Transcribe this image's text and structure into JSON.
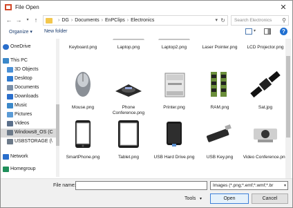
{
  "window": {
    "title": "File Open"
  },
  "address": {
    "crumbs": [
      "DG",
      "Documents",
      "EnPClips",
      "Electronics"
    ],
    "search_placeholder": "Search Electronics"
  },
  "commands": {
    "organize": "Organize ▾",
    "new_folder": "New folder"
  },
  "navigation": [
    {
      "label": "OneDrive",
      "icon": "cloud-icon",
      "color": "#2a6ecb"
    },
    {
      "label": "This PC",
      "icon": "computer-icon",
      "color": "#3b88c9"
    },
    {
      "label": "3D Objects",
      "icon": "cube-icon",
      "color": "#4a90d6"
    },
    {
      "label": "Desktop",
      "icon": "desktop-icon",
      "color": "#2f7bd0"
    },
    {
      "label": "Documents",
      "icon": "documents-icon",
      "color": "#7a8fa8"
    },
    {
      "label": "Downloads",
      "icon": "download-icon",
      "color": "#2a6ecb"
    },
    {
      "label": "Music",
      "icon": "music-icon",
      "color": "#3b88c9"
    },
    {
      "label": "Pictures",
      "icon": "pictures-icon",
      "color": "#5a9bd6"
    },
    {
      "label": "Videos",
      "icon": "videos-icon",
      "color": "#5a6f8a"
    },
    {
      "label": "Windows8_OS (C",
      "icon": "drive-icon",
      "color": "#6c7a89",
      "selected": true
    },
    {
      "label": "USBSTORAGE (\\",
      "icon": "usb-drive-icon",
      "color": "#6c7a89"
    },
    {
      "label": "Network",
      "icon": "network-icon",
      "color": "#2a6ecb"
    },
    {
      "label": "Homegroup",
      "icon": "homegroup-icon",
      "color": "#1f8f5a"
    }
  ],
  "files": [
    {
      "name": "Keyboard.png",
      "icon": "keyboard-icon"
    },
    {
      "name": "Laptop.png",
      "icon": "laptop-icon"
    },
    {
      "name": "Laptop2.png",
      "icon": "laptop-icon"
    },
    {
      "name": "Laser Pointer.png",
      "icon": "laser-pointer-icon"
    },
    {
      "name": "LCD Projector.png",
      "icon": "projector-icon"
    },
    {
      "name": "Mouse.png",
      "icon": "mouse-icon"
    },
    {
      "name": "Phone Conference.png",
      "icon": "conference-phone-icon"
    },
    {
      "name": "Printer.png",
      "icon": "printer-icon"
    },
    {
      "name": "RAM.png",
      "icon": "ram-icon"
    },
    {
      "name": "Sat.jpg",
      "icon": "satellite-icon"
    },
    {
      "name": "SmartPhone.png",
      "icon": "smartphone-icon"
    },
    {
      "name": "Tablet.png",
      "icon": "tablet-icon"
    },
    {
      "name": "USB Hard Drive.png",
      "icon": "hard-drive-icon"
    },
    {
      "name": "USB Key.png",
      "icon": "usb-key-icon"
    },
    {
      "name": "Video Conference.png",
      "icon": "video-conference-icon"
    }
  ],
  "footer": {
    "file_name_label": "File name:",
    "file_name_value": "",
    "filter": "Images (*.png;*.emf;*.wmf;*.br",
    "tools": "Tools",
    "open": "Open",
    "cancel": "Cancel"
  }
}
